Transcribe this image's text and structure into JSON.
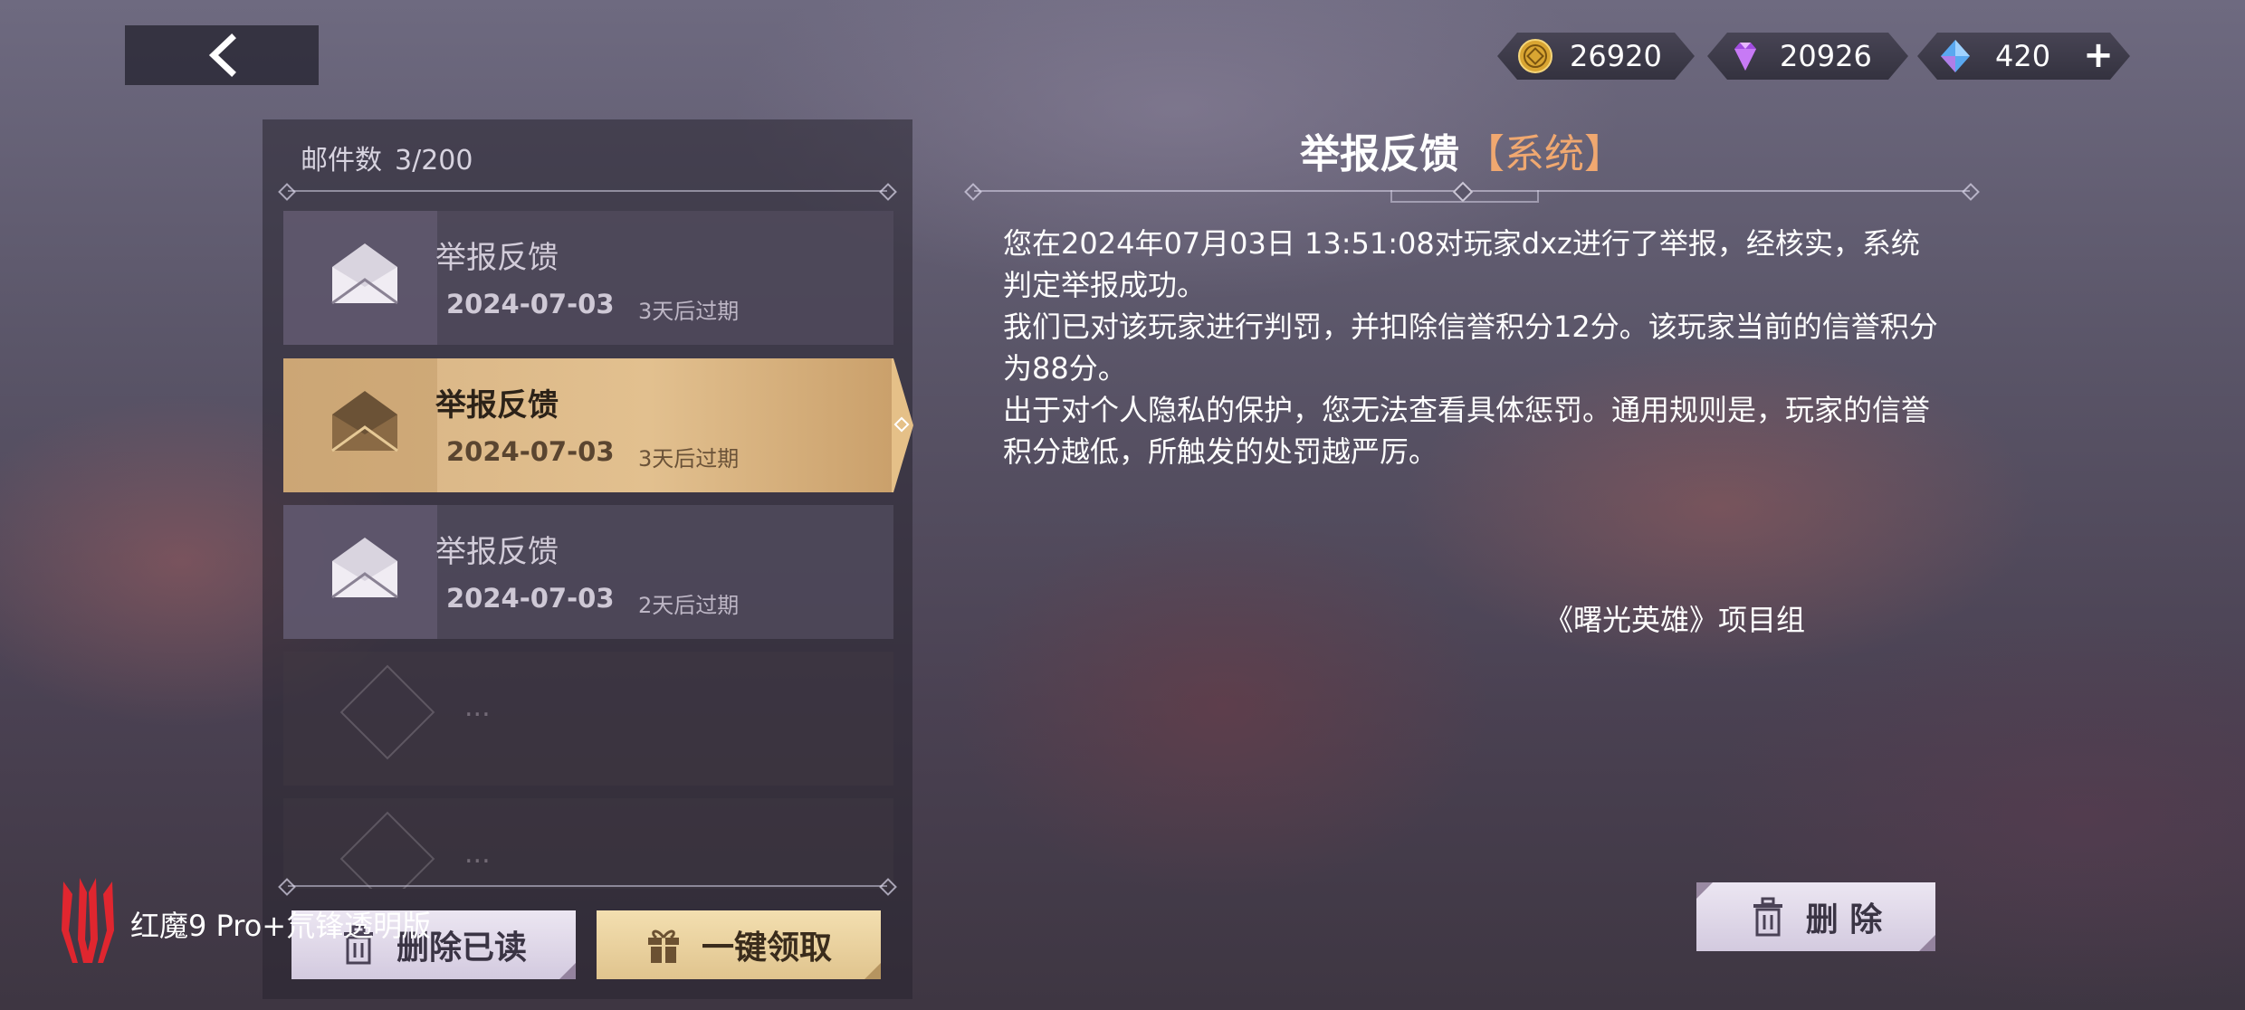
{
  "header": {
    "back_icon": "chevron-left-icon"
  },
  "currencies": [
    {
      "icon": "gold-coin-icon",
      "value": "26920"
    },
    {
      "icon": "purple-gem-icon",
      "value": "20926"
    },
    {
      "icon": "blue-crystal-icon",
      "value": "420",
      "action": "+"
    }
  ],
  "mail_list": {
    "count_label": "邮件数",
    "count_value": "3/200",
    "items": [
      {
        "title": "举报反馈",
        "date": "2024-07-03",
        "expire": "3天后过期",
        "selected": false
      },
      {
        "title": "举报反馈",
        "date": "2024-07-03",
        "expire": "3天后过期",
        "selected": true
      },
      {
        "title": "举报反馈",
        "date": "2024-07-03",
        "expire": "2天后过期",
        "selected": false
      }
    ],
    "empty_placeholder": "...",
    "delete_read_label": "删除已读",
    "claim_all_label": "一键领取"
  },
  "mail_detail": {
    "title": "举报反馈",
    "tag": "【系统】",
    "body": [
      "您在2024年07月03日 13:51:08对玩家dxz进行了举报，经核实，系统判定举报成功。",
      "我们已对该玩家进行判罚，并扣除信誉积分12分。该玩家当前的信誉积分为88分。",
      "出于对个人隐私的保护，您无法查看具体惩罚。通用规则是，玩家的信誉积分越低，所触发的处罚越严厉。"
    ],
    "signature": "《曙光英雄》项目组",
    "delete_label": "删 除"
  },
  "watermark": {
    "text": "红魔9 Pro+氘锋透明版"
  },
  "colors": {
    "selected_item": "#e2c08f",
    "tag": "#f0a870"
  }
}
